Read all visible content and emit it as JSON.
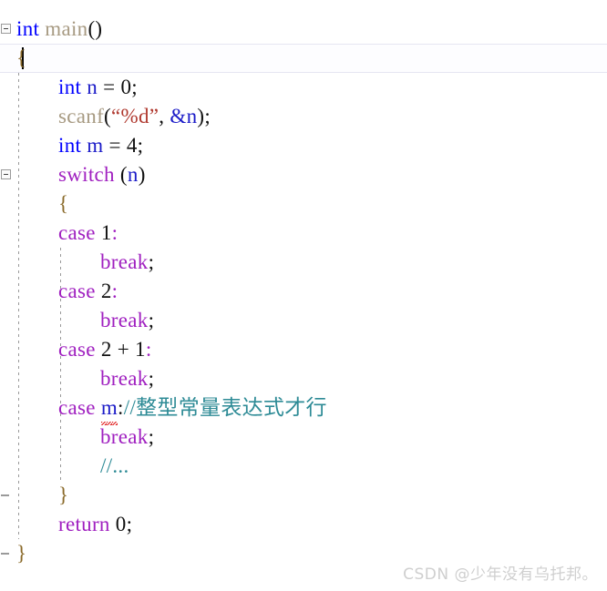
{
  "app": {
    "kind": "code-editor",
    "language": "C",
    "background": "#ffffff"
  },
  "colors": {
    "keyword_type": "#0000ff",
    "keyword_control": "#a020c0",
    "function": "#a79a82",
    "string": "#b03a30",
    "variable": "#1c1cc8",
    "number": "#101010",
    "brace": "#8a6a2a",
    "comment": "#2e8b96",
    "error_squiggle": "#e01b1b",
    "current_line_background": "#fdfdff",
    "current_line_border": "#e6e6f2",
    "fold_margin_line": "#9a9a9a",
    "watermark": "#cfcfcf"
  },
  "editor": {
    "caret_line_index": 1,
    "lines": [
      {
        "index": 0,
        "indent": 0,
        "text": "int main()",
        "tokens": [
          {
            "t": "int",
            "c": "t-key"
          },
          {
            "t": " ",
            "c": "t-punct"
          },
          {
            "t": "main",
            "c": "t-fn"
          },
          {
            "t": "()",
            "c": "t-punct"
          }
        ]
      },
      {
        "index": 1,
        "indent": 0,
        "text": "{",
        "tokens": [
          {
            "t": "{",
            "c": "t-brace"
          }
        ]
      },
      {
        "index": 2,
        "indent": 1,
        "text": "int n = 0;",
        "tokens": [
          {
            "t": "int",
            "c": "t-key"
          },
          {
            "t": " ",
            "c": "t-punct"
          },
          {
            "t": "n",
            "c": "t-var"
          },
          {
            "t": " = ",
            "c": "t-punct"
          },
          {
            "t": "0",
            "c": "t-num"
          },
          {
            "t": ";",
            "c": "t-punct"
          }
        ]
      },
      {
        "index": 3,
        "indent": 1,
        "text": "scanf(\"%d\", &n);",
        "tokens": [
          {
            "t": "scanf",
            "c": "t-fn"
          },
          {
            "t": "(",
            "c": "t-punct"
          },
          {
            "t": "“%d”",
            "c": "t-str"
          },
          {
            "t": ", ",
            "c": "t-punct"
          },
          {
            "t": "&n",
            "c": "t-var"
          },
          {
            "t": ");",
            "c": "t-punct"
          }
        ]
      },
      {
        "index": 4,
        "indent": 1,
        "text": "int m = 4;",
        "tokens": [
          {
            "t": "int",
            "c": "t-key"
          },
          {
            "t": " ",
            "c": "t-punct"
          },
          {
            "t": "m",
            "c": "t-var"
          },
          {
            "t": " = ",
            "c": "t-punct"
          },
          {
            "t": "4",
            "c": "t-num"
          },
          {
            "t": ";",
            "c": "t-punct"
          }
        ]
      },
      {
        "index": 5,
        "indent": 1,
        "text": "switch (n)",
        "tokens": [
          {
            "t": "switch",
            "c": "t-ctl"
          },
          {
            "t": " (",
            "c": "t-punct"
          },
          {
            "t": "n",
            "c": "t-var"
          },
          {
            "t": ")",
            "c": "t-punct"
          }
        ]
      },
      {
        "index": 6,
        "indent": 1,
        "text": "{",
        "tokens": [
          {
            "t": "{",
            "c": "t-brace"
          }
        ]
      },
      {
        "index": 7,
        "indent": 1,
        "text": "case 1:",
        "tokens": [
          {
            "t": "case",
            "c": "t-ctl"
          },
          {
            "t": " ",
            "c": "t-punct"
          },
          {
            "t": "1",
            "c": "t-num"
          },
          {
            "t": ":",
            "c": "t-ctl"
          }
        ]
      },
      {
        "index": 8,
        "indent": 2,
        "text": "break;",
        "tokens": [
          {
            "t": "break",
            "c": "t-ctl"
          },
          {
            "t": ";",
            "c": "t-punct"
          }
        ]
      },
      {
        "index": 9,
        "indent": 1,
        "text": "case 2:",
        "tokens": [
          {
            "t": "case",
            "c": "t-ctl"
          },
          {
            "t": " ",
            "c": "t-punct"
          },
          {
            "t": "2",
            "c": "t-num"
          },
          {
            "t": ":",
            "c": "t-ctl"
          }
        ]
      },
      {
        "index": 10,
        "indent": 2,
        "text": "break;",
        "tokens": [
          {
            "t": "break",
            "c": "t-ctl"
          },
          {
            "t": ";",
            "c": "t-punct"
          }
        ]
      },
      {
        "index": 11,
        "indent": 1,
        "text": "case 2 + 1:",
        "tokens": [
          {
            "t": "case",
            "c": "t-ctl"
          },
          {
            "t": " ",
            "c": "t-punct"
          },
          {
            "t": "2",
            "c": "t-num"
          },
          {
            "t": " + ",
            "c": "t-punct"
          },
          {
            "t": "1",
            "c": "t-num"
          },
          {
            "t": ":",
            "c": "t-ctl"
          }
        ]
      },
      {
        "index": 12,
        "indent": 2,
        "text": "break;",
        "tokens": [
          {
            "t": "break",
            "c": "t-ctl"
          },
          {
            "t": ";",
            "c": "t-punct"
          }
        ]
      },
      {
        "index": 13,
        "indent": 1,
        "text": "case m://整型常量表达式才行",
        "has_error": true,
        "error_token": "m",
        "tokens": [
          {
            "t": "case",
            "c": "t-ctl"
          },
          {
            "t": " ",
            "c": "t-punct"
          },
          {
            "t": "m",
            "c": "t-var",
            "error": true
          },
          {
            "t": ":",
            "c": "t-punct"
          },
          {
            "t": "//整型常量表达式才行",
            "c": "t-cmt"
          }
        ]
      },
      {
        "index": 14,
        "indent": 2,
        "text": "break;",
        "tokens": [
          {
            "t": "break",
            "c": "t-ctl"
          },
          {
            "t": ";",
            "c": "t-punct"
          }
        ]
      },
      {
        "index": 15,
        "indent": 2,
        "text": "//...",
        "tokens": [
          {
            "t": "//...",
            "c": "t-cmt"
          }
        ]
      },
      {
        "index": 16,
        "indent": 1,
        "text": "}",
        "tokens": [
          {
            "t": "}",
            "c": "t-brace"
          }
        ]
      },
      {
        "index": 17,
        "indent": 1,
        "text": "return 0;",
        "tokens": [
          {
            "t": "return",
            "c": "t-ctl"
          },
          {
            "t": " ",
            "c": "t-punct"
          },
          {
            "t": "0",
            "c": "t-num"
          },
          {
            "t": ";",
            "c": "t-punct"
          }
        ]
      },
      {
        "index": 18,
        "indent": 0,
        "text": "}",
        "tokens": [
          {
            "t": "}",
            "c": "t-brace"
          }
        ]
      }
    ],
    "fold_boxes": [
      {
        "name": "fold-toggle-main",
        "line": 0
      },
      {
        "name": "fold-toggle-switch",
        "line": 5
      }
    ],
    "fold_ends": [
      {
        "name": "fold-end-switch",
        "line": 16
      },
      {
        "name": "fold-end-main",
        "line": 18
      }
    ],
    "indent_guides": [
      {
        "level": 1,
        "from_line": 2,
        "to_line": 18
      },
      {
        "level": 2,
        "from_line": 8,
        "to_line": 16
      }
    ]
  },
  "watermark": {
    "text": "CSDN @少年没有乌托邦。"
  }
}
